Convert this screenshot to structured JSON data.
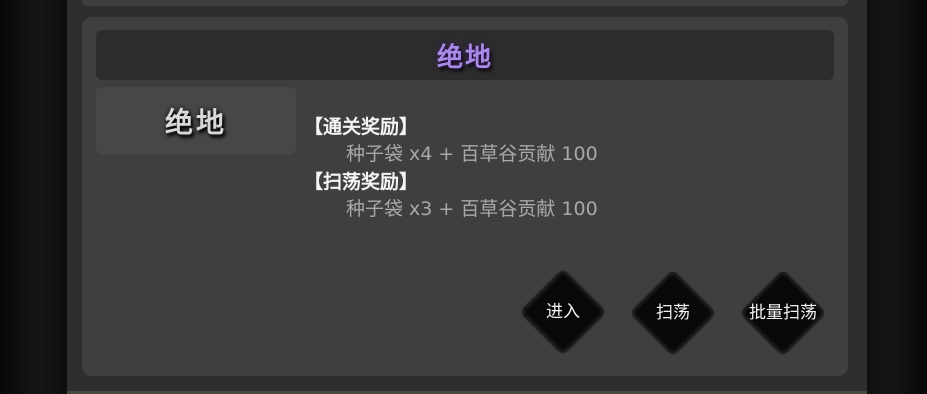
{
  "stage": {
    "title": "绝地",
    "name": "绝地"
  },
  "rewards": {
    "clear": {
      "heading": "【通关奖励】",
      "items": "种子袋 x4 + 百草谷贡献 100"
    },
    "sweep": {
      "heading": "【扫荡奖励】",
      "items": "种子袋 x3 + 百草谷贡献 100"
    }
  },
  "buttons": {
    "enter": "进入",
    "sweep": "扫荡",
    "batch_sweep": "批量扫荡"
  },
  "colors": {
    "title": "#a98ae6",
    "panel": "#3f3f3f",
    "title_bar": "#2c2c2c",
    "button_ink": "#080808"
  }
}
